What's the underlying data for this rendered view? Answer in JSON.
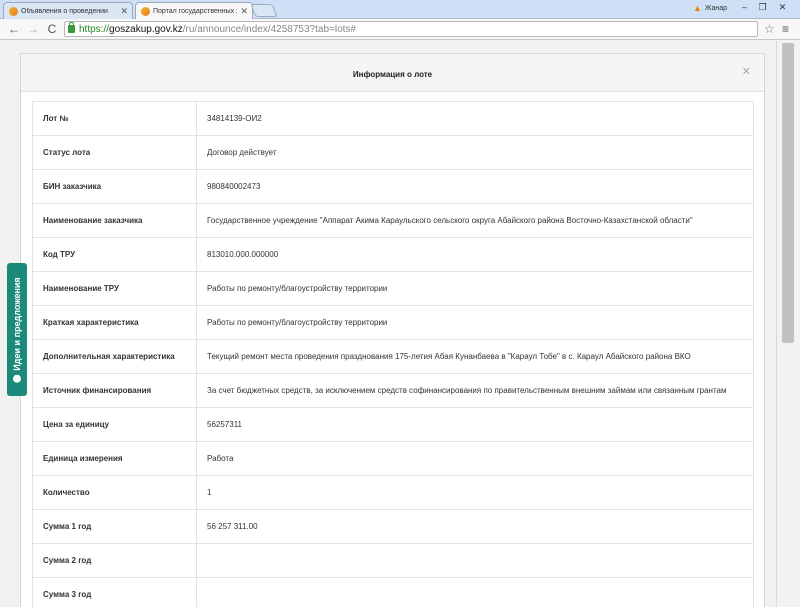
{
  "browser": {
    "tabs": [
      {
        "title": "Объявления о проведении",
        "active": false
      },
      {
        "title": "Портал государственных з",
        "active": true
      }
    ],
    "user_name": "Жанар",
    "url": {
      "scheme": "https://",
      "host": "goszakup.gov.kz",
      "path": "/ru/announce/index/4258753?tab=lots#"
    }
  },
  "side_tab": {
    "label": "Идеи и предложения"
  },
  "modal": {
    "title": "Информация о лоте",
    "rows": [
      {
        "label": "Лот №",
        "value": "34814139-ОИ2"
      },
      {
        "label": "Статус лота",
        "value": "Договор действует"
      },
      {
        "label": "БИН заказчика",
        "value": "980840002473"
      },
      {
        "label": "Наименование заказчика",
        "value": "Государственное учреждение \"Аппарат Акима Караульского сельского округа Абайского района Восточно-Казахстанской области\""
      },
      {
        "label": "Код ТРУ",
        "value": "813010.000.000000"
      },
      {
        "label": "Наименование ТРУ",
        "value": "Работы по ремонту/благоустройству территории"
      },
      {
        "label": "Краткая характеристика",
        "value": "Работы по ремонту/благоустройству территории"
      },
      {
        "label": "Дополнительная характеристика",
        "value": "Текущий ремонт места проведения празднования 175-летия Абая Кунанбаева в \"Караул Тобе\" в с. Караул Абайского района ВКО"
      },
      {
        "label": "Источник финансирования",
        "value": "За счет бюджетных средств, за исключением средств софинансирования по правительственным внешним займам или связанным грантам"
      },
      {
        "label": "Цена за единицу",
        "value": "56257311"
      },
      {
        "label": "Единица измерения",
        "value": "Работа"
      },
      {
        "label": "Количество",
        "value": "1"
      },
      {
        "label": "Сумма 1 год",
        "value": "56 257 311.00"
      },
      {
        "label": "Сумма 2 год",
        "value": ""
      },
      {
        "label": "Сумма 3 год",
        "value": ""
      }
    ]
  }
}
